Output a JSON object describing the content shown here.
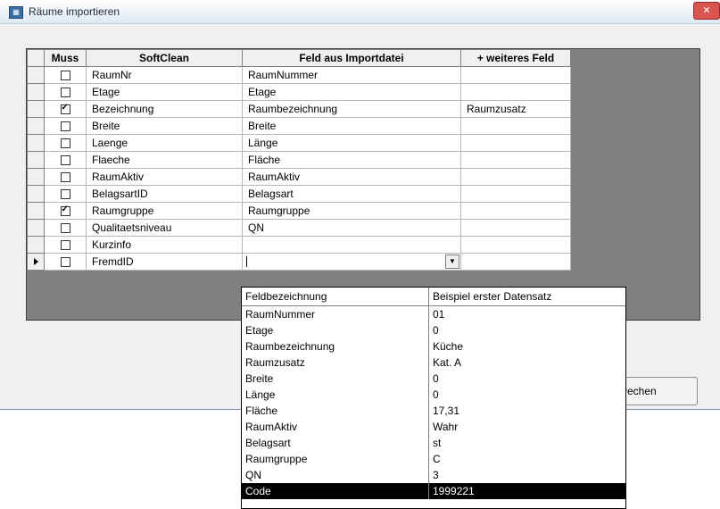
{
  "window": {
    "title": "Räume importieren"
  },
  "grid": {
    "headers": [
      "Muss",
      "SoftClean",
      "Feld aus Importdatei",
      "+ weiteres Feld"
    ],
    "rows": [
      {
        "muss": false,
        "softclean": "RaumNr",
        "import": "RaumNummer",
        "extra": ""
      },
      {
        "muss": false,
        "softclean": "Etage",
        "import": "Etage",
        "extra": ""
      },
      {
        "muss": true,
        "softclean": "Bezeichnung",
        "import": "Raumbezeichnung",
        "extra": "Raumzusatz"
      },
      {
        "muss": false,
        "softclean": "Breite",
        "import": "Breite",
        "extra": ""
      },
      {
        "muss": false,
        "softclean": "Laenge",
        "import": "Länge",
        "extra": ""
      },
      {
        "muss": false,
        "softclean": "Flaeche",
        "import": "Fläche",
        "extra": ""
      },
      {
        "muss": false,
        "softclean": "RaumAktiv",
        "import": "RaumAktiv",
        "extra": ""
      },
      {
        "muss": false,
        "softclean": "BelagsartID",
        "import": "Belagsart",
        "extra": ""
      },
      {
        "muss": true,
        "softclean": "Raumgruppe",
        "import": "Raumgruppe",
        "extra": ""
      },
      {
        "muss": false,
        "softclean": "Qualitaetsniveau",
        "import": "QN",
        "extra": ""
      },
      {
        "muss": false,
        "softclean": "Kurzinfo",
        "import": "",
        "extra": ""
      },
      {
        "muss": false,
        "softclean": "FremdID",
        "import": "",
        "extra": "",
        "current": true
      }
    ]
  },
  "dropdown": {
    "headers": [
      "Feldbezeichnung",
      "Beispiel erster Datensatz"
    ],
    "items": [
      {
        "field": "RaumNummer",
        "example": "01"
      },
      {
        "field": "Etage",
        "example": "0"
      },
      {
        "field": "Raumbezeichnung",
        "example": "Küche"
      },
      {
        "field": "Raumzusatz",
        "example": "Kat. A"
      },
      {
        "field": "Breite",
        "example": "0"
      },
      {
        "field": "Länge",
        "example": "0"
      },
      {
        "field": "Fläche",
        "example": "17,31"
      },
      {
        "field": "RaumAktiv",
        "example": "Wahr"
      },
      {
        "field": "Belagsart",
        "example": "st"
      },
      {
        "field": "Raumgruppe",
        "example": "C"
      },
      {
        "field": "QN",
        "example": "3"
      },
      {
        "field": "Code",
        "example": "1999221",
        "highlighted": true
      }
    ]
  },
  "buttons": {
    "partial_label": "rechen"
  }
}
